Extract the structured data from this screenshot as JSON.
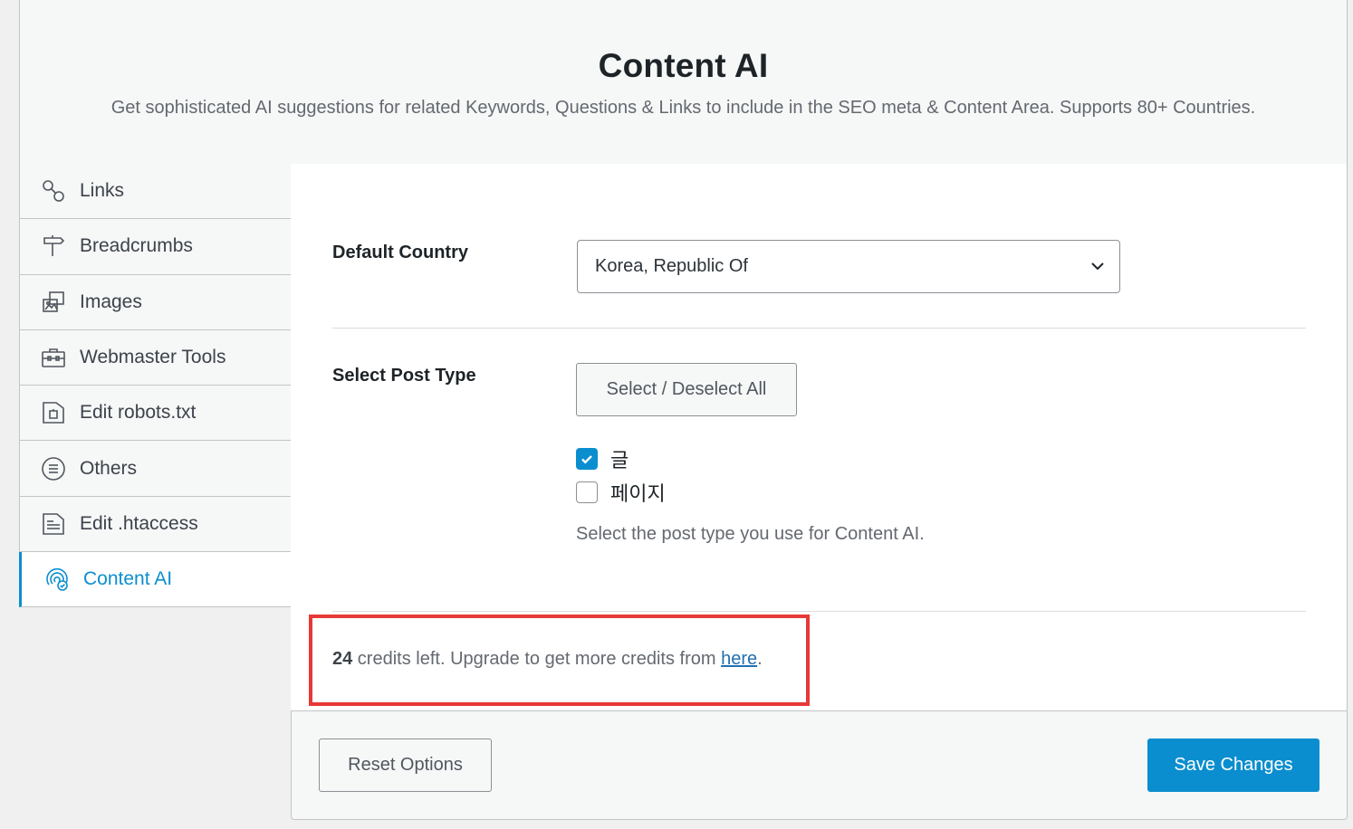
{
  "header": {
    "title": "Content AI",
    "subtitle": "Get sophisticated AI suggestions for related Keywords, Questions & Links to include in the SEO meta & Content Area. Supports 80+ Countries."
  },
  "sidebar": {
    "items": [
      {
        "label": "Links",
        "icon": "link-icon",
        "active": false
      },
      {
        "label": "Breadcrumbs",
        "icon": "signpost-icon",
        "active": false
      },
      {
        "label": "Images",
        "icon": "images-icon",
        "active": false
      },
      {
        "label": "Webmaster Tools",
        "icon": "toolbox-icon",
        "active": false
      },
      {
        "label": "Edit robots.txt",
        "icon": "robots-file-icon",
        "active": false
      },
      {
        "label": "Others",
        "icon": "list-circle-icon",
        "active": false
      },
      {
        "label": "Edit .htaccess",
        "icon": "htaccess-file-icon",
        "active": false
      },
      {
        "label": "Content AI",
        "icon": "content-ai-icon",
        "active": true
      }
    ]
  },
  "settings": {
    "default_country": {
      "label": "Default Country",
      "value": "Korea, Republic Of"
    },
    "post_type": {
      "label": "Select Post Type",
      "toggle_all_label": "Select / Deselect All",
      "options": [
        {
          "label": "글",
          "checked": true
        },
        {
          "label": "페이지",
          "checked": false
        }
      ],
      "hint": "Select the post type you use for Content AI."
    },
    "credits": {
      "count": "24",
      "text": " credits left. Upgrade to get more credits from ",
      "link_label": "here",
      "suffix": "."
    }
  },
  "footer": {
    "reset_label": "Reset Options",
    "save_label": "Save Changes"
  },
  "colors": {
    "accent": "#0b8ecf",
    "highlight_box": "#e83838"
  }
}
